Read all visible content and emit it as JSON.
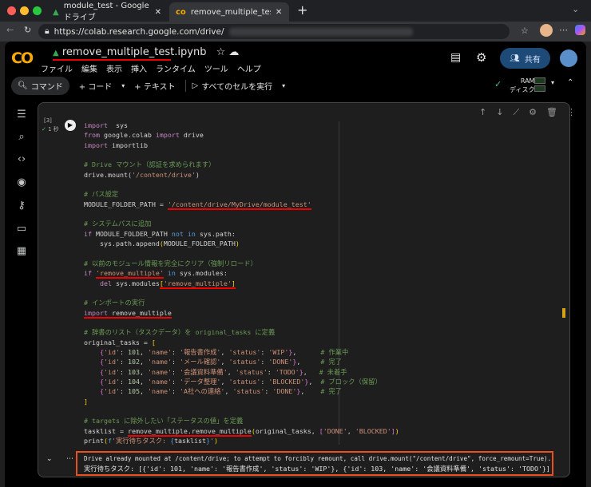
{
  "browser": {
    "tabs": [
      {
        "label": "module_test - Google ドライブ",
        "icon": "google-drive-icon"
      },
      {
        "label": "remove_multiple_test.ipynb - Co",
        "icon": "colab-icon",
        "active": true
      }
    ],
    "url": "https://colab.research.google.com/drive/"
  },
  "colab": {
    "logo": "CO",
    "notebook_title": "remove_multiple_test.ipynb",
    "menu": [
      "ファイル",
      "編集",
      "表示",
      "挿入",
      "ランタイム",
      "ツール",
      "ヘルプ"
    ],
    "share_label": "共有",
    "toolbar": {
      "command": "コマンド",
      "add_code": "+ コード",
      "add_text": "+ テキスト",
      "run_all": "すべてのセルを実行",
      "ram_label": "RAM",
      "disk_label": "ディスク"
    }
  },
  "cell": {
    "exec_count": "[3]",
    "exec_time": "1 秒",
    "code_lines": [
      [
        [
          "k",
          "import"
        ],
        [
          "",
          "  sys"
        ]
      ],
      [
        [
          "k",
          "from"
        ],
        [
          "",
          " google.colab "
        ],
        [
          "k",
          "import"
        ],
        [
          "",
          " drive"
        ]
      ],
      [
        [
          "k",
          "import"
        ],
        [
          "",
          " importlib"
        ]
      ],
      [],
      [
        [
          "c",
          "# Drive マウント（認証を求められます）"
        ]
      ],
      [
        [
          "",
          "drive.mount("
        ],
        [
          "s",
          "'/content/drive'"
        ],
        [
          "",
          ")"
        ]
      ],
      [],
      [
        [
          "c",
          "# パス設定"
        ]
      ],
      [
        [
          "",
          "MODULE_FOLDER_PATH = "
        ],
        [
          "s ul",
          "'/content/drive/MyDrive/module_test'"
        ]
      ],
      [],
      [
        [
          "c",
          "# システムパスに追加"
        ]
      ],
      [
        [
          "k",
          "if"
        ],
        [
          "",
          " MODULE_FOLDER_PATH "
        ],
        [
          "f",
          "not in"
        ],
        [
          "",
          " sys.path:"
        ]
      ],
      [
        [
          "",
          "    sys.path.append"
        ],
        [
          "b",
          "("
        ],
        [
          "",
          "MODULE_FOLDER_PATH"
        ],
        [
          "b",
          ")"
        ]
      ],
      [],
      [
        [
          "c",
          "# 以前のモジュール情報を完全にクリア（強制リロード）"
        ]
      ],
      [
        [
          "k",
          "if"
        ],
        [
          "",
          " "
        ],
        [
          "s ul",
          "'remove_multiple'"
        ],
        [
          "f",
          " in"
        ],
        [
          "",
          " sys.modules:"
        ]
      ],
      [
        [
          "k",
          "    del"
        ],
        [
          "",
          " sys.modules"
        ],
        [
          "b ul",
          "["
        ],
        [
          "s ul",
          "'remove_multiple'"
        ],
        [
          "b ul",
          "]"
        ]
      ],
      [],
      [
        [
          "c",
          "# インポートの実行"
        ]
      ],
      [
        [
          "k ul",
          "import"
        ],
        [
          "ul",
          " remove_multiple"
        ]
      ],
      [],
      [
        [
          "c",
          "# 辞書のリスト（タスクデータ）を original_tasks に定義"
        ]
      ],
      [
        [
          "",
          "original_tasks = "
        ],
        [
          "b",
          "["
        ]
      ],
      [
        [
          "m",
          "    {"
        ],
        [
          "s",
          "'id'"
        ],
        [
          "",
          ": "
        ],
        [
          "n",
          "101"
        ],
        [
          "",
          ", "
        ],
        [
          "s",
          "'name'"
        ],
        [
          "",
          ": "
        ],
        [
          "s",
          "'報告書作成'"
        ],
        [
          "",
          ", "
        ],
        [
          "s",
          "'status'"
        ],
        [
          "",
          ": "
        ],
        [
          "s",
          "'WIP'"
        ],
        [
          "m",
          "}"
        ],
        [
          "",
          ",      "
        ],
        [
          "c",
          "# 作業中"
        ]
      ],
      [
        [
          "m",
          "    {"
        ],
        [
          "s",
          "'id'"
        ],
        [
          "",
          ": "
        ],
        [
          "n",
          "102"
        ],
        [
          "",
          ", "
        ],
        [
          "s",
          "'name'"
        ],
        [
          "",
          ": "
        ],
        [
          "s",
          "'メール確認'"
        ],
        [
          "",
          ", "
        ],
        [
          "s",
          "'status'"
        ],
        [
          "",
          ": "
        ],
        [
          "s",
          "'DONE'"
        ],
        [
          "m",
          "}"
        ],
        [
          "",
          ",     "
        ],
        [
          "c",
          "# 完了"
        ]
      ],
      [
        [
          "m",
          "    {"
        ],
        [
          "s",
          "'id'"
        ],
        [
          "",
          ": "
        ],
        [
          "n",
          "103"
        ],
        [
          "",
          ", "
        ],
        [
          "s",
          "'name'"
        ],
        [
          "",
          ": "
        ],
        [
          "s",
          "'会議資料準備'"
        ],
        [
          "",
          ", "
        ],
        [
          "s",
          "'status'"
        ],
        [
          "",
          ": "
        ],
        [
          "s",
          "'TODO'"
        ],
        [
          "m",
          "}"
        ],
        [
          "",
          ",   "
        ],
        [
          "c",
          "# 未着手"
        ]
      ],
      [
        [
          "m",
          "    {"
        ],
        [
          "s",
          "'id'"
        ],
        [
          "",
          ": "
        ],
        [
          "n",
          "104"
        ],
        [
          "",
          ", "
        ],
        [
          "s",
          "'name'"
        ],
        [
          "",
          ": "
        ],
        [
          "s",
          "'データ整理'"
        ],
        [
          "",
          ", "
        ],
        [
          "s",
          "'status'"
        ],
        [
          "",
          ": "
        ],
        [
          "s",
          "'BLOCKED'"
        ],
        [
          "m",
          "}"
        ],
        [
          "",
          ",  "
        ],
        [
          "c",
          "# ブロック（保留）"
        ]
      ],
      [
        [
          "m",
          "    {"
        ],
        [
          "s",
          "'id'"
        ],
        [
          "",
          ": "
        ],
        [
          "n",
          "105"
        ],
        [
          "",
          ", "
        ],
        [
          "s",
          "'name'"
        ],
        [
          "",
          ": "
        ],
        [
          "s",
          "'A社への連絡'"
        ],
        [
          "",
          ", "
        ],
        [
          "s",
          "'status'"
        ],
        [
          "",
          ": "
        ],
        [
          "s",
          "'DONE'"
        ],
        [
          "m",
          "}"
        ],
        [
          "",
          ",    "
        ],
        [
          "c",
          "# 完了"
        ]
      ],
      [
        [
          "b",
          "]"
        ]
      ],
      [],
      [
        [
          "c",
          "# targets に除外したい「ステータスの値」を定義"
        ]
      ],
      [
        [
          "",
          "tasklist = "
        ],
        [
          "ul",
          "remove_multiple.remove_multiple"
        ],
        [
          "b",
          "("
        ],
        [
          "",
          "original_tasks, "
        ],
        [
          "m",
          "["
        ],
        [
          "s",
          "'DONE'"
        ],
        [
          "",
          ", "
        ],
        [
          "s",
          "'BLOCKED'"
        ],
        [
          "m",
          "]"
        ],
        [
          "b",
          ")"
        ]
      ],
      [
        [
          "",
          "print"
        ],
        [
          "b",
          "("
        ],
        [
          "f",
          "f"
        ],
        [
          "s",
          "'実行待ちタスク: "
        ],
        [
          "f",
          "{"
        ],
        [
          "",
          "tasklist"
        ],
        [
          "f",
          "}"
        ],
        [
          "s",
          "'"
        ],
        [
          "b",
          ")"
        ]
      ]
    ],
    "output_lines": [
      "Drive already mounted at /content/drive; to attempt to forcibly remount, call drive.mount(\"/content/drive\", force_remount=True).",
      "実行待ちタスク: [{'id': 101, 'name': '報告書作成', 'status': 'WIP'}, {'id': 103, 'name': '会議資料準備', 'status': 'TODO'}]"
    ]
  },
  "colors": {
    "accent_highlight": "#e8501f",
    "underline": "#ee0000",
    "share_button": "#1e4a78"
  }
}
